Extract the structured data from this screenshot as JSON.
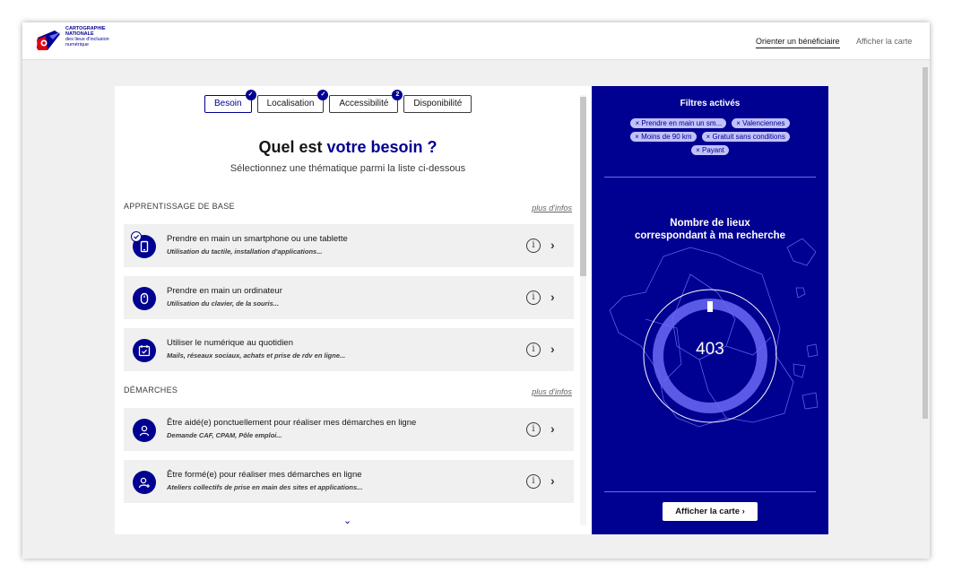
{
  "header": {
    "logo_lines": [
      "CARTOGRAPHIE",
      "NATIONALE"
    ],
    "logo_sub_lines": [
      "des lieux d'inclusion",
      "numérique"
    ],
    "nav": [
      {
        "label": "Orienter un bénéficiaire",
        "active": true
      },
      {
        "label": "Afficher la carte",
        "active": false
      }
    ]
  },
  "tabs": [
    {
      "label": "Besoin",
      "badge": "check",
      "active": true
    },
    {
      "label": "Localisation",
      "badge": "check",
      "active": false
    },
    {
      "label": "Accessibilité",
      "badge": "2",
      "active": false
    },
    {
      "label": "Disponibilité",
      "badge": "",
      "active": false
    }
  ],
  "main": {
    "heading_prefix": "Quel est",
    "heading_accent": "votre besoin ?",
    "subheading": "Sélectionnez une thématique parmi la liste ci-dessous"
  },
  "sections": [
    {
      "title": "APPRENTISSAGE DE BASE",
      "more_info": "plus d'infos",
      "items": [
        {
          "title": "Prendre en main un smartphone ou une tablette",
          "desc": "Utilisation du tactile, installation d'applications...",
          "icon": "smartphone-icon",
          "selected": true
        },
        {
          "title": "Prendre en main un ordinateur",
          "desc": "Utilisation du clavier, de la souris...",
          "icon": "mouse-icon",
          "selected": false
        },
        {
          "title": "Utiliser le numérique au quotidien",
          "desc": "Mails, réseaux sociaux, achats et prise de rdv en ligne...",
          "icon": "calendar-check-icon",
          "selected": false
        }
      ]
    },
    {
      "title": "DÉMARCHES",
      "more_info": "plus d'infos",
      "items": [
        {
          "title": "Être aidé(e) ponctuellement pour réaliser mes démarches en ligne",
          "desc": "Demande CAF, CPAM, Pôle emploi...",
          "icon": "user-icon",
          "selected": false
        },
        {
          "title": "Être formé(e) pour réaliser mes démarches en ligne",
          "desc": "Ateliers collectifs de prise en main des sites et applications...",
          "icon": "user-add-icon",
          "selected": false
        }
      ]
    }
  ],
  "sidebar": {
    "filters_title": "Filtres activés",
    "filters": [
      "× Prendre en main un sm...",
      "× Valenciennes",
      "× Moins de 90 km",
      "× Gratuit sans conditions",
      "× Payant"
    ],
    "count_title_line1": "Nombre de lieux",
    "count_title_line2": "correspondant à ma recherche",
    "count_value": "403",
    "count_progress": 0.01,
    "show_map_button": "Afficher la carte ›"
  },
  "colors": {
    "brand_blue": "#000091",
    "chip_bg": "#c1c1fb",
    "card_bg": "#f0f0f0"
  }
}
